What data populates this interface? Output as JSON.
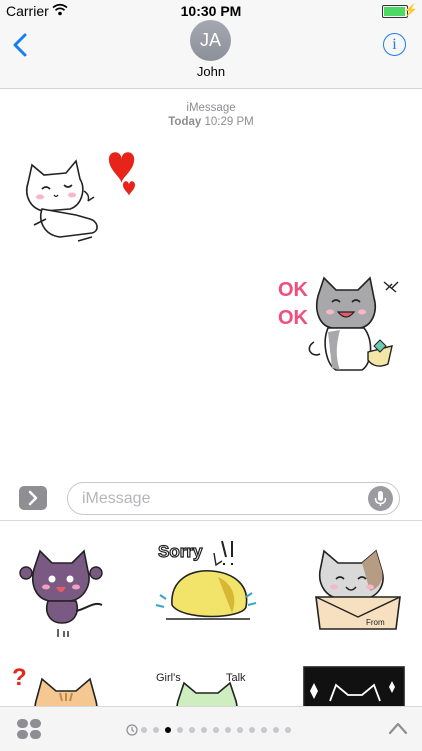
{
  "status_bar": {
    "carrier": "Carrier",
    "time": "10:30 PM"
  },
  "header": {
    "avatar_initials": "JA",
    "contact_name": "John"
  },
  "thread": {
    "service": "iMessage",
    "day": "Today",
    "time": "10:29 PM"
  },
  "composer": {
    "placeholder": "iMessage"
  },
  "stickers": {
    "received": {
      "icon": "white-cat-with-hearts"
    },
    "sent": {
      "text": "OK OK",
      "icon": "grey-cat-ok"
    },
    "drawer_texts": {
      "sorry": "Sorry",
      "from": "From",
      "girls": "Girl's",
      "talk": "Talk"
    }
  },
  "pager": {
    "pages": 13,
    "current": 3
  },
  "colors": {
    "accent": "#1a7cf2",
    "battery": "#4cd964",
    "heart": "#e8231a"
  }
}
